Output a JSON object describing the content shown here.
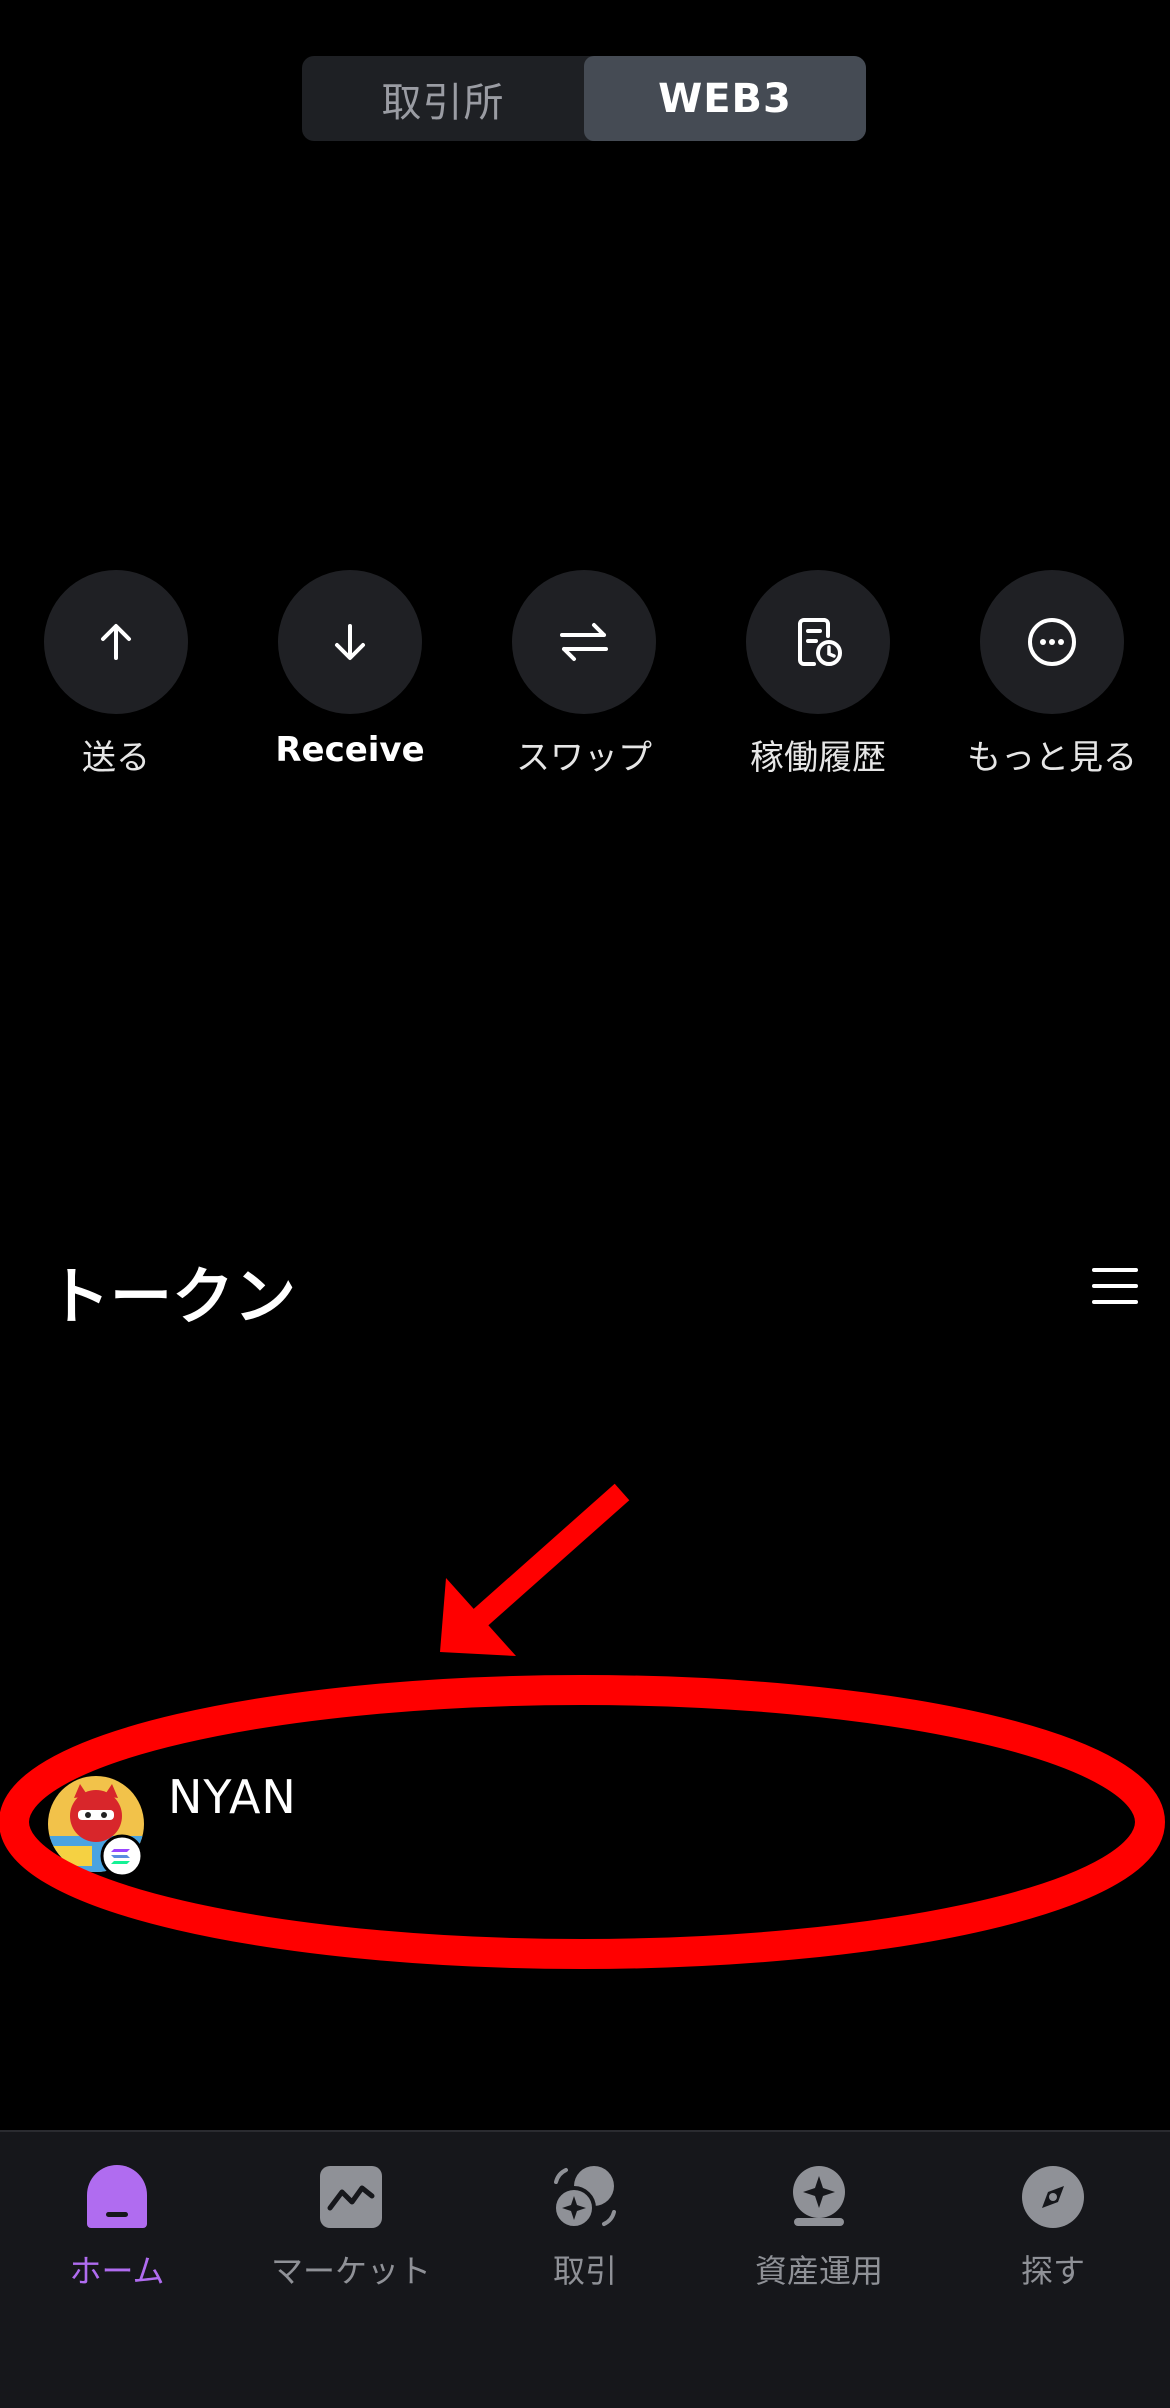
{
  "toggle": {
    "options": [
      "取引所",
      "WEB3"
    ],
    "selected": "WEB3"
  },
  "actions": [
    {
      "label": "送る",
      "icon": "arrow-up-icon"
    },
    {
      "label": "Receive",
      "icon": "arrow-down-icon"
    },
    {
      "label": "スワップ",
      "icon": "swap-icon"
    },
    {
      "label": "稼働履歴",
      "icon": "history-icon"
    },
    {
      "label": "もっと見る",
      "icon": "more-icon"
    }
  ],
  "tokens": {
    "title": "トークン",
    "items": [
      {
        "name": "NYAN",
        "network_icon": "solana-icon"
      }
    ]
  },
  "annotation": {
    "color": "#ff0000",
    "shapes": [
      "red-arrow",
      "red-ellipse"
    ]
  },
  "nav": {
    "items": [
      {
        "label": "ホーム",
        "icon": "home-icon",
        "active": true
      },
      {
        "label": "マーケット",
        "icon": "market-chart-icon",
        "active": false
      },
      {
        "label": "取引",
        "icon": "trade-icon",
        "active": false
      },
      {
        "label": "資産運用",
        "icon": "earn-icon",
        "active": false
      },
      {
        "label": "探す",
        "icon": "compass-icon",
        "active": false
      }
    ],
    "active_color": "#b06cf0"
  }
}
